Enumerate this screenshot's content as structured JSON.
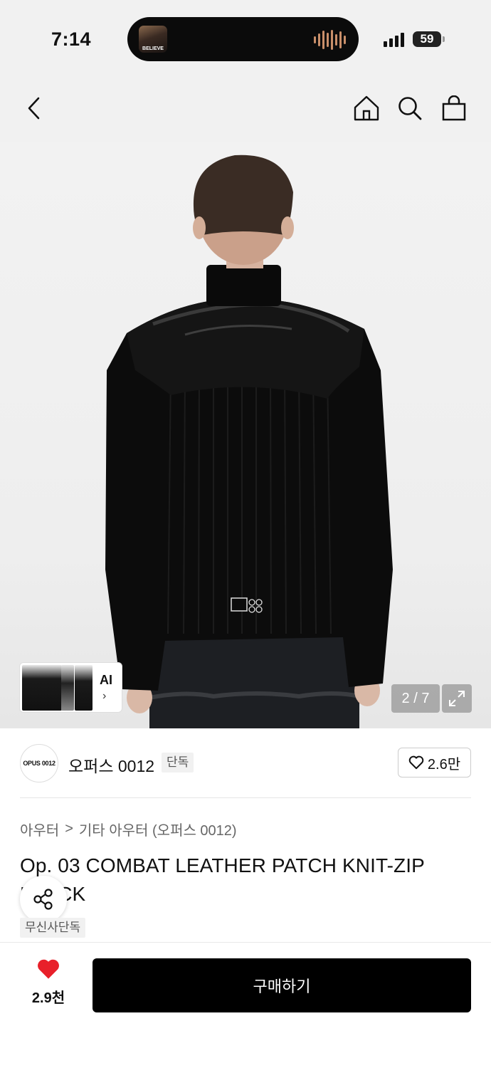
{
  "status_bar": {
    "time": "7:14",
    "now_playing_cover_text": "BELIEVE",
    "battery": "59"
  },
  "nav": {
    "back_icon": "chevron-left-icon",
    "home_icon": "home-icon",
    "search_icon": "search-icon",
    "cart_icon": "shopping-bag-icon"
  },
  "gallery": {
    "ai_label": "AI",
    "counter": "2 / 7",
    "current_index": 2,
    "total": 7
  },
  "brand": {
    "logo_text": "OPUS 0012",
    "name": "오퍼스 0012",
    "badge": "단독",
    "likes": "2.6만"
  },
  "breadcrumb": {
    "category": "아우터",
    "separator": ">",
    "subcategory": "기타 아우터 (오퍼스 0012)"
  },
  "product": {
    "title": "Op. 03 COMBAT LEATHER PATCH KNIT-ZIP BLACK",
    "badge": "무신사단독"
  },
  "bottom_bar": {
    "wish_count": "2.9천",
    "buy_label": "구매하기"
  },
  "colors": {
    "heart": "#e8202a",
    "buy_button": "#000000",
    "badge_bg": "#f1f1f1"
  }
}
